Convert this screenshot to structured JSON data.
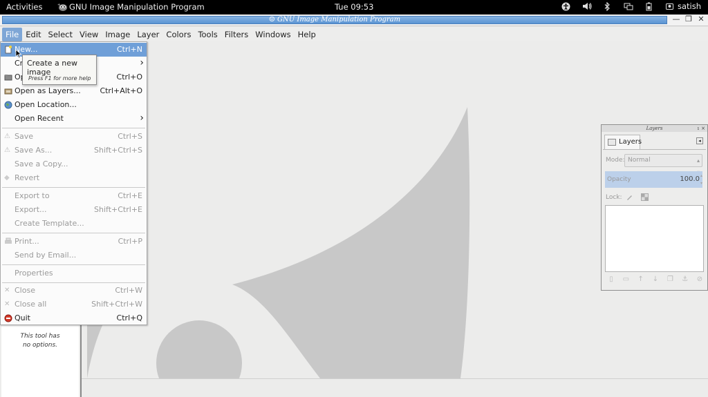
{
  "topbar": {
    "activities": "Activities",
    "app_name": "GNU Image Manipulation Program",
    "clock": "Tue 09:53",
    "user": "satish",
    "tray_icons": [
      "accessibility-icon",
      "volume-icon",
      "bluetooth-icon",
      "display-icon",
      "battery-icon",
      "user-icon"
    ]
  },
  "window": {
    "title": "GNU Image Manipulation Program",
    "buttons": [
      "minimize",
      "maximize",
      "close"
    ]
  },
  "menubar": {
    "items": [
      "File",
      "Edit",
      "Select",
      "View",
      "Image",
      "Layer",
      "Colors",
      "Tools",
      "Filters",
      "Windows",
      "Help"
    ],
    "active": "File"
  },
  "file_menu": {
    "items": [
      {
        "label": "New...",
        "accel": "Ctrl+N",
        "state": "highlighted",
        "icon": "new-document-icon"
      },
      {
        "label": "Cr",
        "accel": "",
        "state": "normal",
        "submenu": true
      },
      {
        "label": "Op",
        "accel": "Ctrl+O",
        "state": "normal",
        "icon": "open-folder-icon"
      },
      {
        "label": "Open as Layers...",
        "accel": "Ctrl+Alt+O",
        "state": "normal",
        "icon": "open-layers-icon"
      },
      {
        "label": "Open Location...",
        "accel": "",
        "state": "normal",
        "icon": "globe-icon"
      },
      {
        "label": "Open Recent",
        "accel": "",
        "state": "normal",
        "submenu": true
      },
      {
        "label": "Save",
        "accel": "Ctrl+S",
        "state": "disabled",
        "icon": "save-icon"
      },
      {
        "label": "Save As...",
        "accel": "Shift+Ctrl+S",
        "state": "disabled",
        "icon": "save-as-icon"
      },
      {
        "label": "Save a Copy...",
        "accel": "",
        "state": "disabled"
      },
      {
        "label": "Revert",
        "accel": "",
        "state": "disabled",
        "icon": "revert-icon"
      },
      {
        "label": "Export to",
        "accel": "Ctrl+E",
        "state": "disabled"
      },
      {
        "label": "Export...",
        "accel": "Shift+Ctrl+E",
        "state": "disabled"
      },
      {
        "label": "Create Template...",
        "accel": "",
        "state": "disabled"
      },
      {
        "label": "Print...",
        "accel": "Ctrl+P",
        "state": "disabled",
        "icon": "print-icon"
      },
      {
        "label": "Send by Email...",
        "accel": "",
        "state": "disabled"
      },
      {
        "label": "Properties",
        "accel": "",
        "state": "disabled"
      },
      {
        "label": "Close",
        "accel": "Ctrl+W",
        "state": "disabled",
        "icon": "close-icon"
      },
      {
        "label": "Close all",
        "accel": "Shift+Ctrl+W",
        "state": "disabled",
        "icon": "close-all-icon"
      },
      {
        "label": "Quit",
        "accel": "Ctrl+Q",
        "state": "normal",
        "icon": "quit-icon"
      }
    ]
  },
  "tooltip": {
    "title": "Create a new image",
    "hint": "Press F1 for more help"
  },
  "tool_options": {
    "message_line1": "This tool has",
    "message_line2": "no options."
  },
  "layers_dock": {
    "header": "Layers",
    "tab_label": "Layers",
    "mode_label": "Mode:",
    "mode_value": "Normal",
    "opacity_label": "Opacity",
    "opacity_value": "100.0",
    "lock_label": "Lock:"
  },
  "colors": {
    "menu_highlight": "#6f9fd8",
    "title_strip": "#5b94d3",
    "watermark": "#c8c8c8",
    "opacity_fill": "#bcd0ea"
  }
}
